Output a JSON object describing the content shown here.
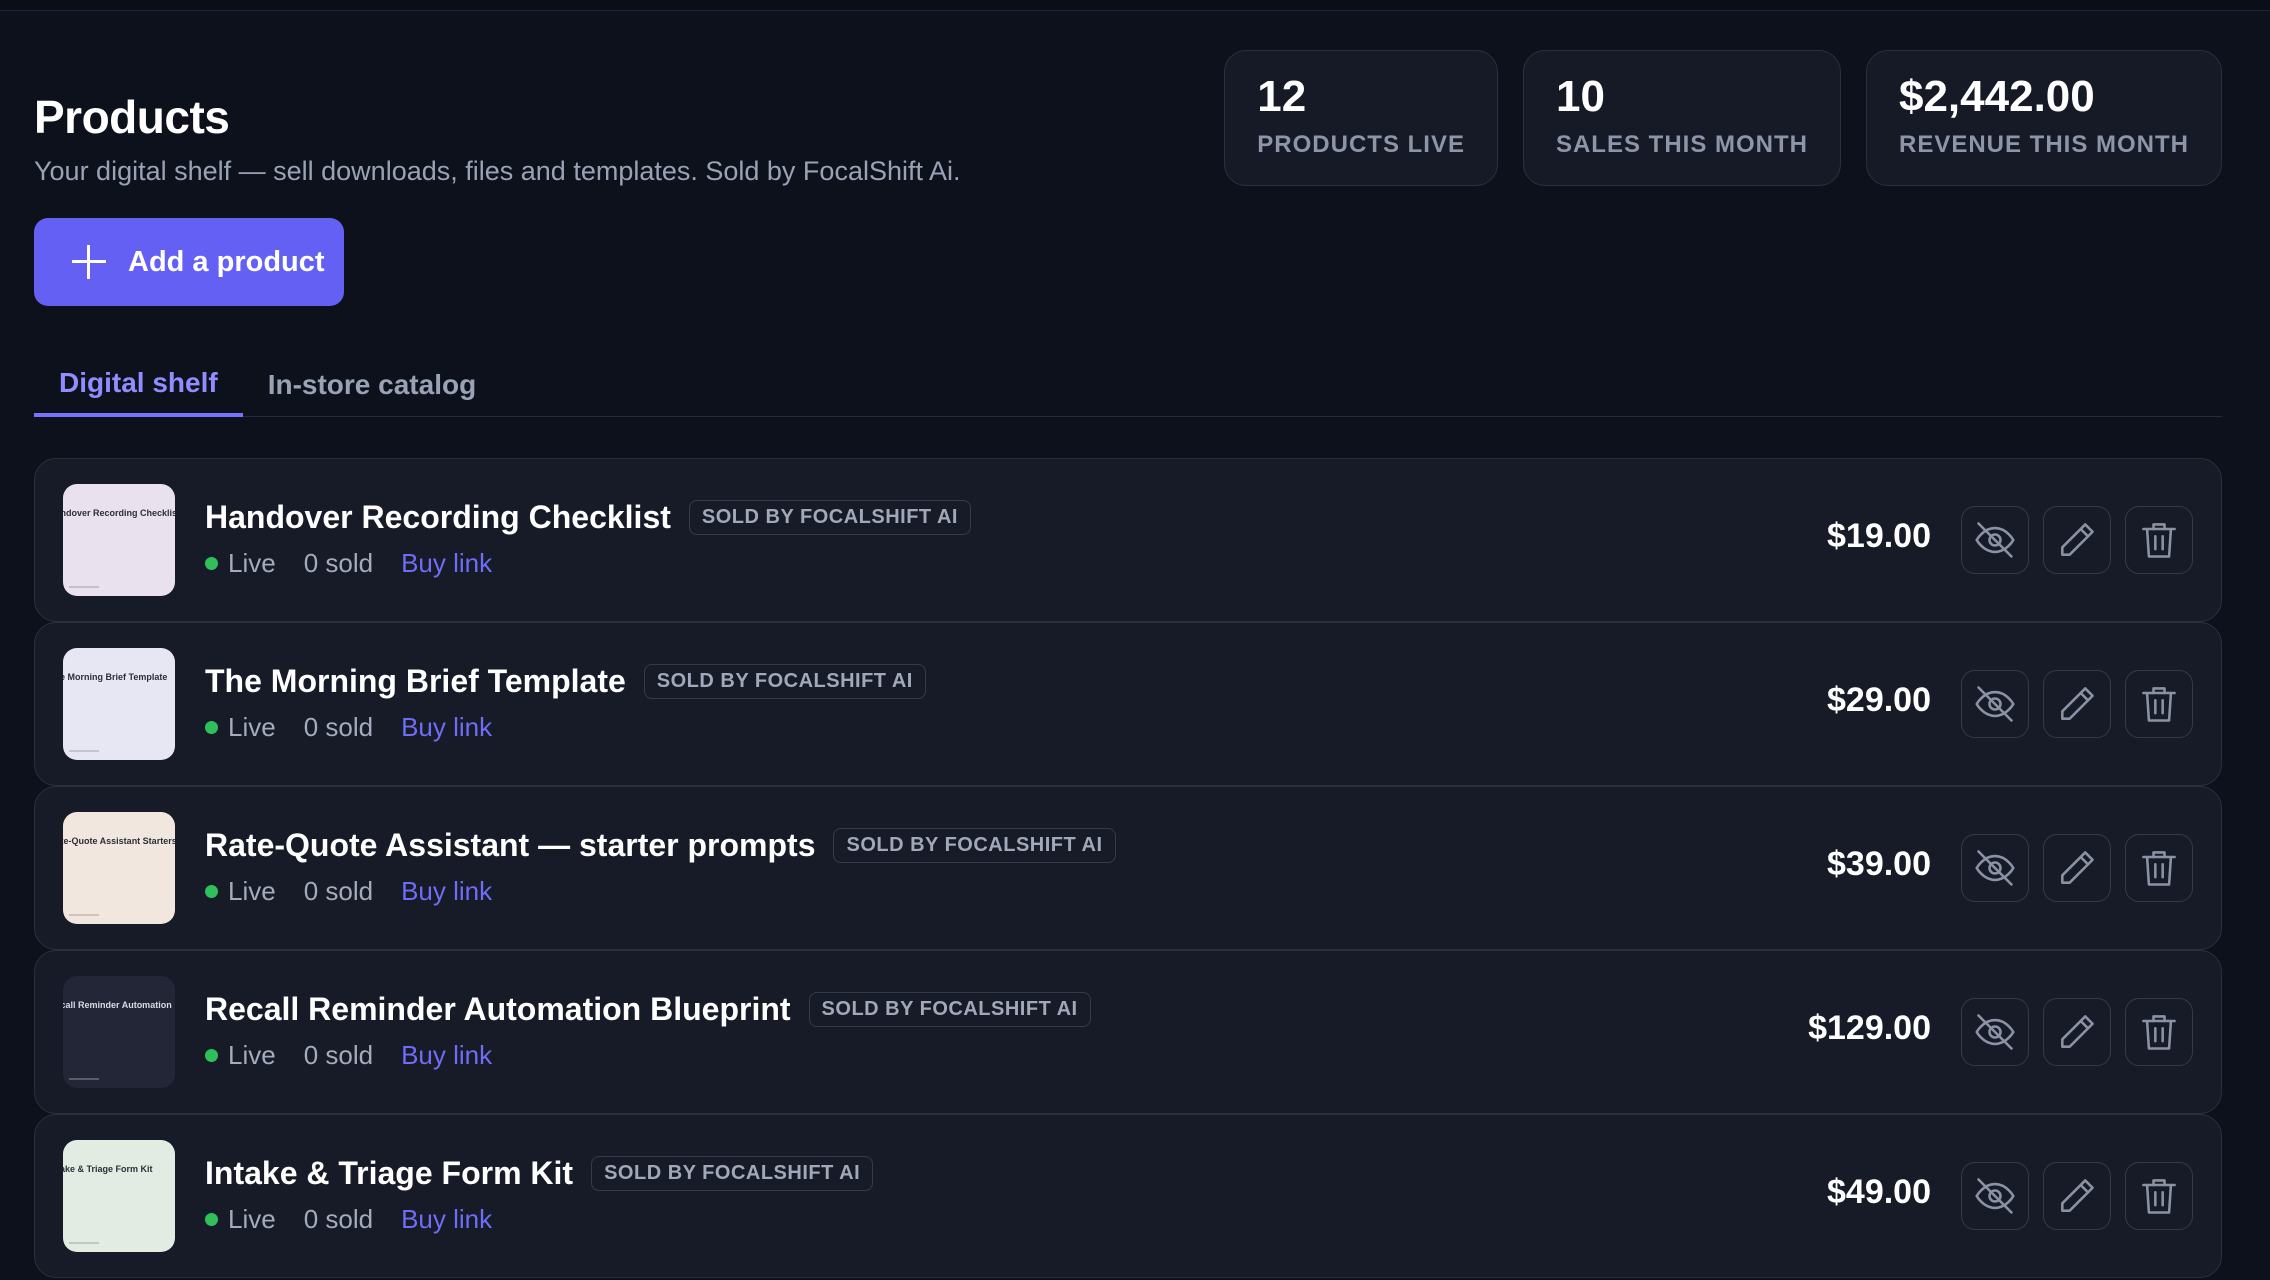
{
  "header": {
    "title": "Products",
    "subtitle": "Your digital shelf — sell downloads, files and templates. Sold by FocalShift Ai."
  },
  "stats": [
    {
      "value": "12",
      "label": "PRODUCTS LIVE"
    },
    {
      "value": "10",
      "label": "SALES THIS MONTH"
    },
    {
      "value": "$2,442.00",
      "label": "REVENUE THIS MONTH"
    }
  ],
  "add_button": {
    "label": "Add a product",
    "icon": "plus-icon"
  },
  "tabs": [
    {
      "label": "Digital shelf",
      "active": true
    },
    {
      "label": "In-store catalog",
      "active": false
    }
  ],
  "products": [
    {
      "name": "Handover Recording Checklist",
      "badge": "SOLD BY FOCALSHIFT AI",
      "status": "Live",
      "sold": "0 sold",
      "link": "Buy link",
      "price": "$19.00",
      "thumb_title": "Handover Recording Checklist",
      "thumb_color": "#e9e1ee"
    },
    {
      "name": "The Morning Brief Template",
      "badge": "SOLD BY FOCALSHIFT AI",
      "status": "Live",
      "sold": "0 sold",
      "link": "Buy link",
      "price": "$29.00",
      "thumb_title": "The Morning Brief Template",
      "thumb_color": "#e6e7f3"
    },
    {
      "name": "Rate-Quote Assistant — starter prompts",
      "badge": "SOLD BY FOCALSHIFT AI",
      "status": "Live",
      "sold": "0 sold",
      "link": "Buy link",
      "price": "$39.00",
      "thumb_title": "Rate-Quote Assistant Starters",
      "thumb_color": "#f2e7df"
    },
    {
      "name": "Recall Reminder Automation Blueprint",
      "badge": "SOLD BY FOCALSHIFT AI",
      "status": "Live",
      "sold": "0 sold",
      "link": "Buy link",
      "price": "$129.00",
      "thumb_title": "Recall Reminder Automation",
      "thumb_color": "#232636"
    },
    {
      "name": "Intake & Triage Form Kit",
      "badge": "SOLD BY FOCALSHIFT AI",
      "status": "Live",
      "sold": "0 sold",
      "link": "Buy link",
      "price": "$49.00",
      "thumb_title": "Intake & Triage Form Kit",
      "thumb_color": "#e3ece2"
    }
  ],
  "row_actions": [
    "eye-off-icon",
    "pencil-icon",
    "trash-icon"
  ],
  "colors": {
    "background": "#0d111c",
    "accent": "#6360f3",
    "live": "#2fbf5b",
    "link": "#6f6cf6"
  }
}
